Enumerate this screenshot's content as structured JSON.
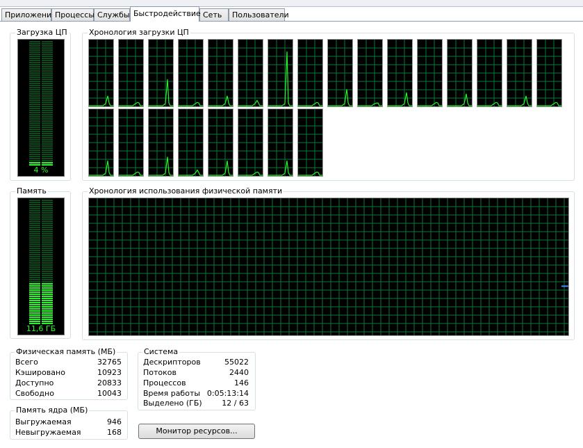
{
  "tabs": [
    {
      "label": "Приложения",
      "active": false
    },
    {
      "label": "Процессы",
      "active": false
    },
    {
      "label": "Службы",
      "active": false
    },
    {
      "label": "Быстродействие",
      "active": true
    },
    {
      "label": "Сеть",
      "active": false
    },
    {
      "label": "Пользователи",
      "active": false
    }
  ],
  "cpu": {
    "title": "Загрузка ЦП",
    "usage_label": "4 %",
    "usage_percent": 4,
    "history_title": "Хронология загрузки ЦП",
    "core_count": 24
  },
  "memory": {
    "title": "Память",
    "usage_label": "11,6 ГБ",
    "usage_fraction": 0.333,
    "history_title": "Хронология использования физической памяти"
  },
  "physical_memory": {
    "title": "Физическая память (МБ)",
    "rows": [
      {
        "label": "Всего",
        "value": "32765"
      },
      {
        "label": "Кэшировано",
        "value": "10923"
      },
      {
        "label": "Доступно",
        "value": "20833"
      },
      {
        "label": "Свободно",
        "value": "10043"
      }
    ]
  },
  "kernel_memory": {
    "title": "Память ядра (МБ)",
    "rows": [
      {
        "label": "Выгружаемая",
        "value": "946"
      },
      {
        "label": "Невыгружаемая",
        "value": "168"
      }
    ]
  },
  "system": {
    "title": "Система",
    "rows": [
      {
        "label": "Дескрипторов",
        "value": "55022"
      },
      {
        "label": "Потоков",
        "value": "2440"
      },
      {
        "label": "Процессов",
        "value": "146"
      },
      {
        "label": "Время работы",
        "value": "0:05:13:14"
      },
      {
        "label": "Выделено (ГБ)",
        "value": "12 / 63"
      }
    ]
  },
  "resource_monitor_button": "Монитор ресурсов...",
  "colors": {
    "graph_line": "#2af52a",
    "grid": "#0b7a3a",
    "memory_line": "#3f8fff"
  }
}
